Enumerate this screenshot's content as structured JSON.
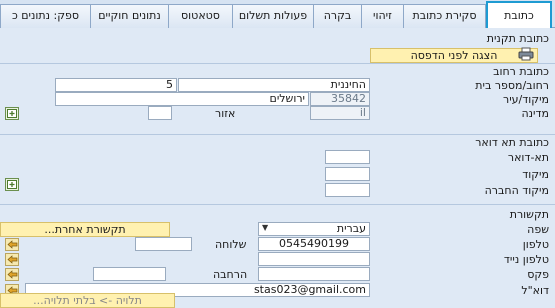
{
  "tabs": [
    {
      "label": "כתובת",
      "active": true
    },
    {
      "label": "סקירת כתובת"
    },
    {
      "label": "זיהוי"
    },
    {
      "label": "בקרה"
    },
    {
      "label": "פעולות תשלום"
    },
    {
      "label": "סטאטוס"
    },
    {
      "label": "נתונים חוקיים"
    },
    {
      "label": "ספק: נתונים כ"
    }
  ],
  "standard_address": {
    "title": "כתובת תקנית",
    "preview_button": "הצגה לפני הדפסה"
  },
  "street_address": {
    "title": "כתובת רחוב",
    "street_label": "רחוב/מספר בית",
    "street_value": "החיננית",
    "house_number": "5",
    "postal_label": "מיקוד/עיר",
    "postal_code": "35842",
    "city": "ירושלים",
    "country_label": "מדינה",
    "country_value": "il",
    "region_label": "אזור",
    "region_value": ""
  },
  "po_box_address": {
    "title": "כתובת תא דואר",
    "po_box_label": "תא-דואר",
    "postal_label": "מיקוד",
    "company_postal_label": "מיקוד החברה"
  },
  "communication": {
    "title": "תקשורת",
    "language_label": "שפה",
    "language_value": "עברית",
    "other_comm_button": "תקשורת אחרת...",
    "phone_label": "טלפון",
    "phone_value": "0545490199",
    "extension_label": "שלוחה",
    "mobile_label": "טלפון נייד",
    "fax_label": "פקס",
    "fax_ext_label": "הרחבה",
    "email_label": "דוא\"ל",
    "email_value": "stas023@gmail.com",
    "dependency_button": "תלויה -> בלתי תלויה..."
  }
}
